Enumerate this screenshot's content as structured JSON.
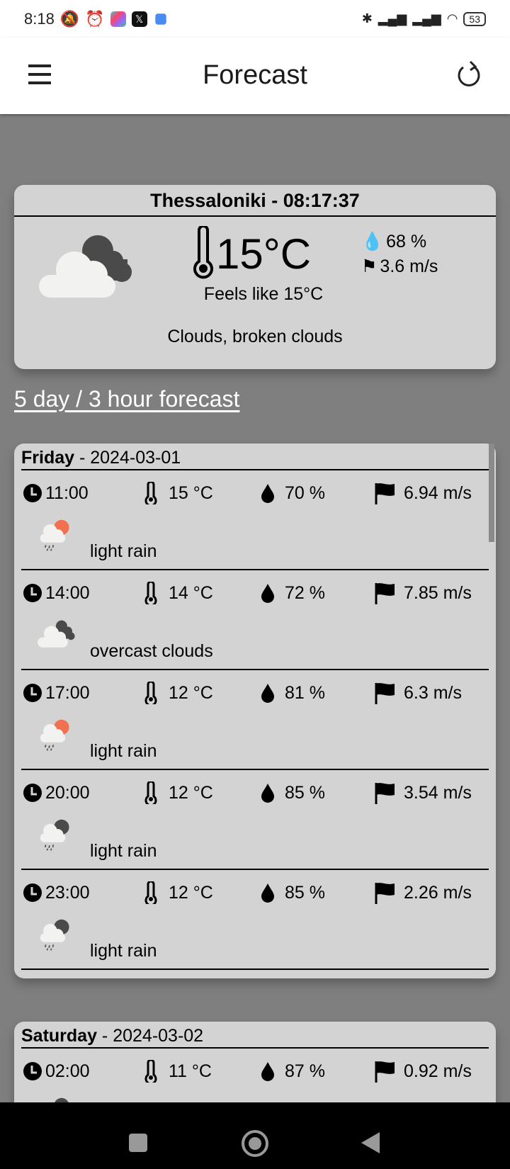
{
  "status_bar": {
    "time": "8:18",
    "battery": "53"
  },
  "app_bar": {
    "title": "Forecast"
  },
  "current": {
    "header": "Thessaloniki - 08:17:37",
    "temperature": "15°C",
    "feels_like": "Feels like 15°C",
    "humidity": "68 %",
    "wind": "3.6 m/s",
    "description": "Clouds, broken clouds",
    "icon": "broken-clouds-icon"
  },
  "forecast_link": "5 day / 3 hour forecast",
  "days": [
    {
      "day": "Friday",
      "date": " - 2024-03-01",
      "rows": [
        {
          "time": "11:00",
          "temp": "15 °C",
          "humidity": "70 %",
          "wind": "6.94 m/s",
          "desc": "light rain",
          "icon": "rain-day"
        },
        {
          "time": "14:00",
          "temp": "14 °C",
          "humidity": "72 %",
          "wind": "7.85 m/s",
          "desc": "overcast clouds",
          "icon": "overcast"
        },
        {
          "time": "17:00",
          "temp": "12 °C",
          "humidity": "81 %",
          "wind": "6.3 m/s",
          "desc": "light rain",
          "icon": "rain-day"
        },
        {
          "time": "20:00",
          "temp": "12 °C",
          "humidity": "85 %",
          "wind": "3.54 m/s",
          "desc": "light rain",
          "icon": "rain-night"
        },
        {
          "time": "23:00",
          "temp": "12 °C",
          "humidity": "85 %",
          "wind": "2.26 m/s",
          "desc": "light rain",
          "icon": "rain-night"
        }
      ]
    },
    {
      "day": "Saturday",
      "date": " - 2024-03-02",
      "rows": [
        {
          "time": "02:00",
          "temp": "11 °C",
          "humidity": "87 %",
          "wind": "0.92 m/s",
          "desc": "",
          "icon": "rain-night"
        }
      ]
    }
  ],
  "colors": {
    "background": "#7f7f7f",
    "card": "#d3d3d3",
    "sun": "#f07050"
  }
}
